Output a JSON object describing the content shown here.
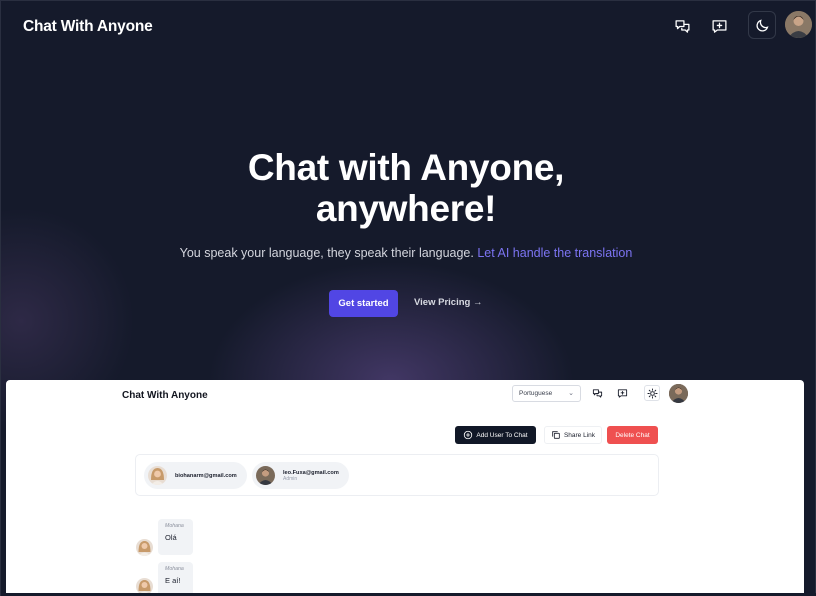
{
  "brand": "Chat With Anyone",
  "nav": {
    "icons": [
      "chats-icon",
      "new-chat-icon",
      "moon-icon"
    ]
  },
  "hero": {
    "title_line1": "Chat with Anyone,",
    "title_line2": "anywhere!",
    "subtitle": "You speak your language, they speak their language.",
    "subtitle_accent": "Let AI handle the translation",
    "cta_primary": "Get started",
    "cta_secondary": "View Pricing →"
  },
  "preview": {
    "brand": "Chat With Anyone",
    "language_select": "Portuguese",
    "buttons": {
      "add_user": "Add User To Chat",
      "share_link": "Share Link",
      "delete_chat": "Delete Chat"
    },
    "users": [
      {
        "email": "biohanarm@gmail.com",
        "role": ""
      },
      {
        "email": "leo.Fuxa@gmail.com",
        "role": "Admin"
      }
    ],
    "messages": [
      {
        "author": "Mohana",
        "text": "Olá"
      },
      {
        "author": "Mohana",
        "text": "E aí!"
      }
    ]
  },
  "colors": {
    "background": "#151a2b",
    "accent": "#5146e4",
    "accent_text": "#7c74f2",
    "danger": "#ef5050"
  }
}
